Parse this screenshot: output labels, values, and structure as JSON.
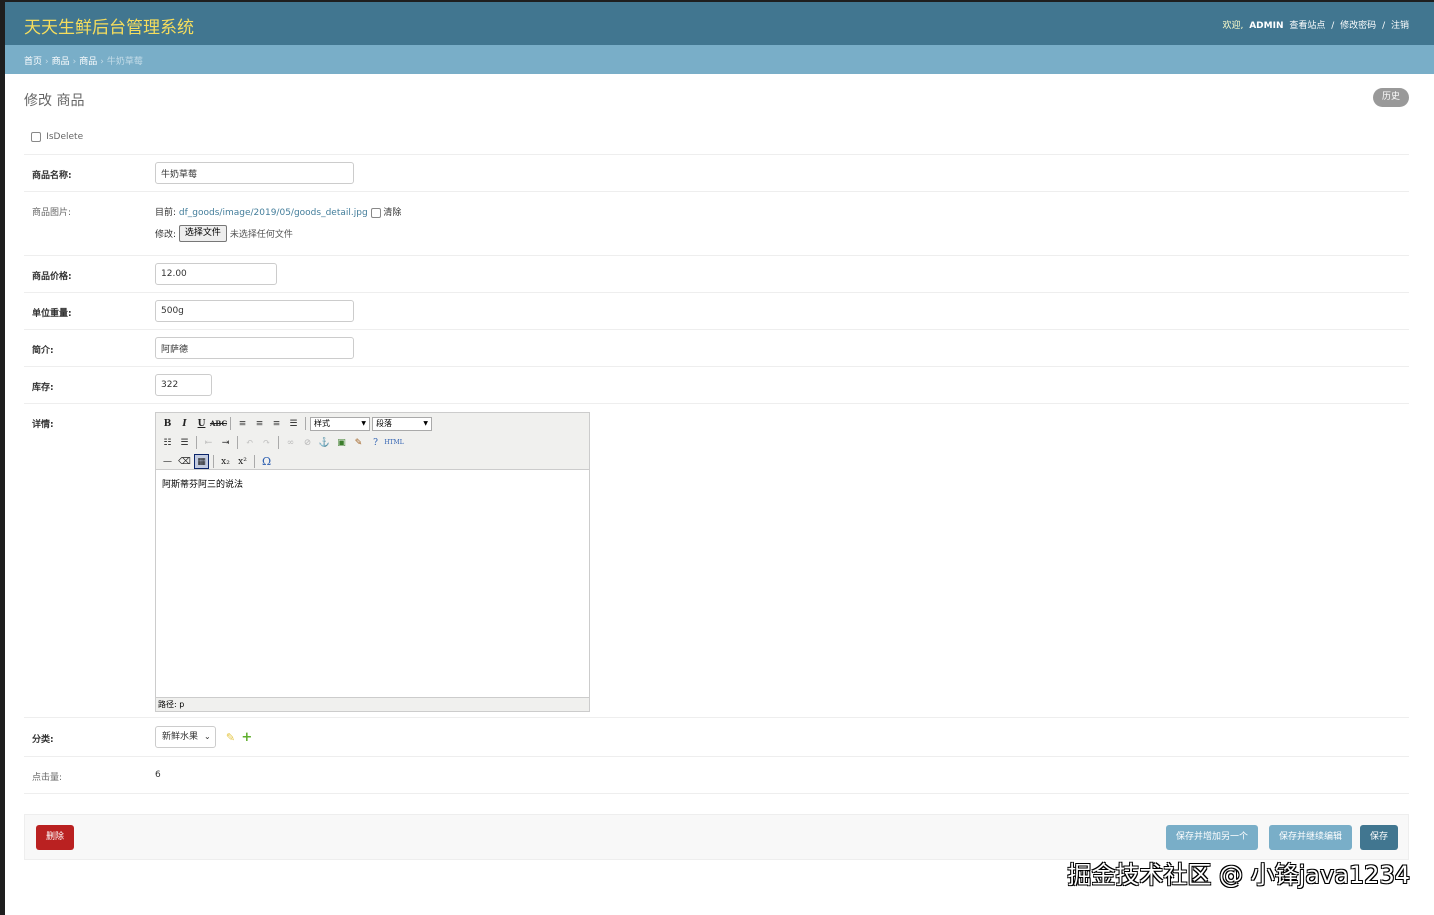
{
  "header": {
    "brand": "天天生鲜后台管理系统",
    "welcome": "欢迎,",
    "username": "ADMIN",
    "view_site": "查看站点",
    "change_password": "修改密码",
    "logout": "注销"
  },
  "breadcrumbs": [
    "首页",
    "商品",
    "商品",
    "牛奶草莓"
  ],
  "page": {
    "title": "修改 商品",
    "history": "历史"
  },
  "form": {
    "isdelete_label": "IsDelete",
    "name_label": "商品名称:",
    "name_value": "牛奶草莓",
    "image_label": "商品图片:",
    "image_current_prefix": "目前:",
    "image_current_path": "df_goods/image/2019/05/goods_detail.jpg",
    "image_clear": "清除",
    "image_change_prefix": "修改:",
    "image_choose_button": "选择文件",
    "image_no_file": "未选择任何文件",
    "price_label": "商品价格:",
    "price_value": "12.00",
    "unit_label": "单位重量:",
    "unit_value": "500g",
    "intro_label": "简介:",
    "intro_value": "阿萨德",
    "stock_label": "库存:",
    "stock_value": "322",
    "detail_label": "详情:",
    "editor": {
      "style_select": "样式",
      "format_select": "段落",
      "content": "阿斯蒂芬阿三的说法",
      "status_path": "路径: p"
    },
    "category_label": "分类:",
    "category_value": "新鲜水果",
    "clicks_label": "点击量:",
    "clicks_value": "6"
  },
  "submit": {
    "delete": "删除",
    "save_add_another": "保存并增加另一个",
    "save_continue": "保存并继续编辑",
    "save": "保存"
  },
  "watermark": "掘金技术社区 @ 小锋java1234",
  "colors": {
    "header_bg": "#417690",
    "brand": "#f5dd5d",
    "breadcrumb_bg": "#79aec8",
    "delete_bg": "#ba2121",
    "default_button": "#417690"
  }
}
